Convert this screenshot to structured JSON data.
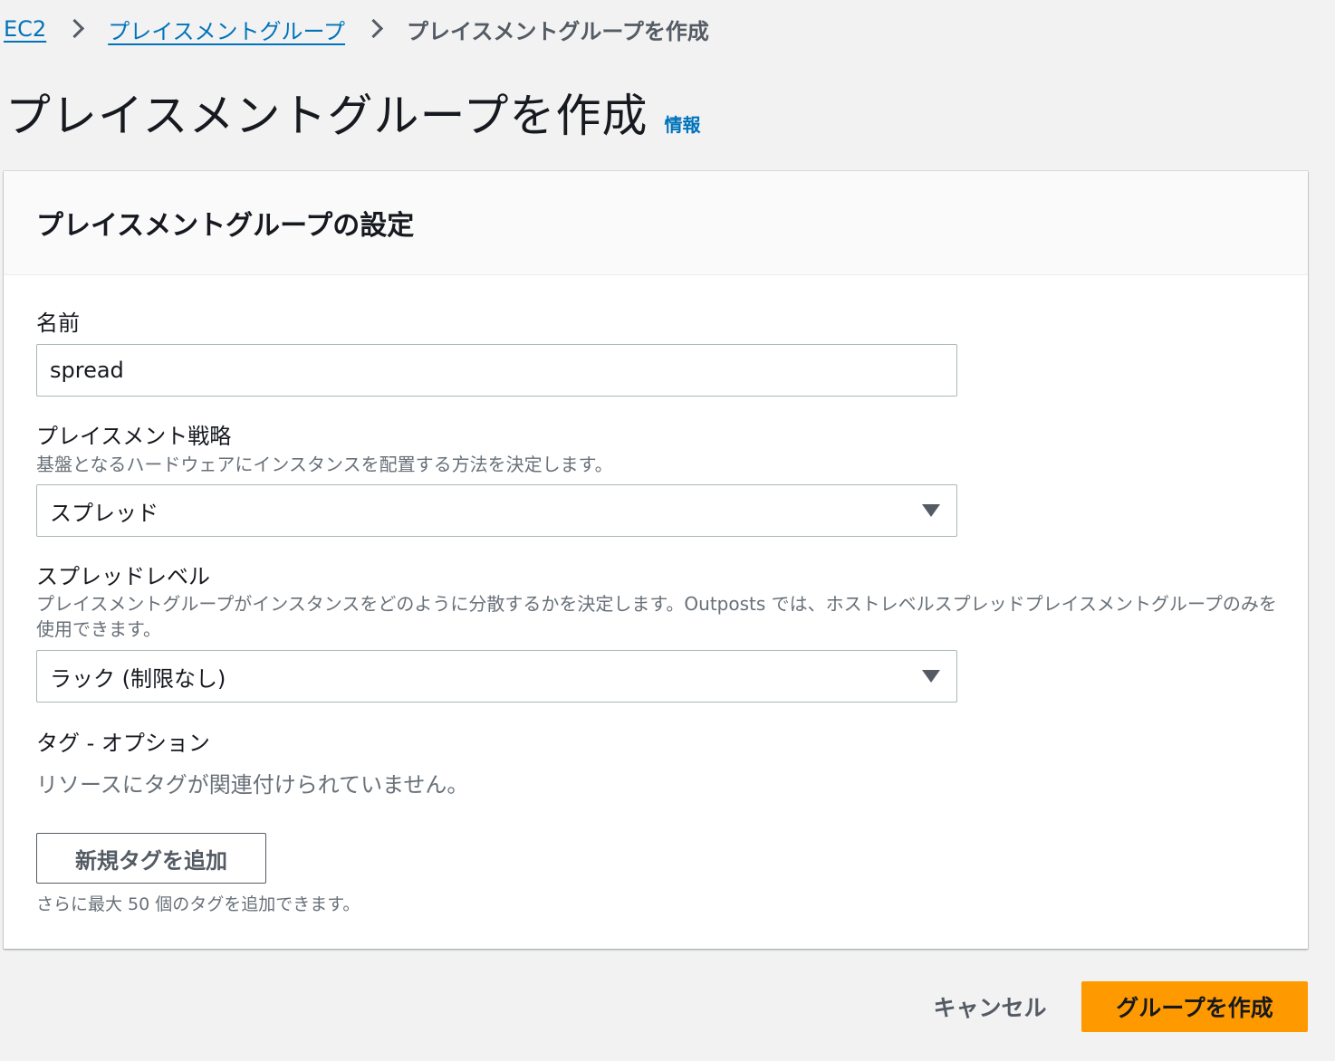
{
  "breadcrumb": {
    "items": [
      "EC2",
      "プレイスメントグループ"
    ],
    "current": "プレイスメントグループを作成"
  },
  "header": {
    "title": "プレイスメントグループを作成",
    "info_link": "情報"
  },
  "settings": {
    "title": "プレイスメントグループの設定",
    "name": {
      "label": "名前",
      "value": "spread"
    },
    "strategy": {
      "label": "プレイスメント戦略",
      "description": "基盤となるハードウェアにインスタンスを配置する方法を決定します。",
      "selected": "スプレッド"
    },
    "spread_level": {
      "label": "スプレッドレベル",
      "description": "プレイスメントグループがインスタンスをどのように分散するかを決定します。Outposts では、ホストレベルスプレッドプレイスメントグループのみを使用できます。",
      "selected": "ラック (制限なし)"
    },
    "tags": {
      "label": "タグ - オプション",
      "empty_text": "リソースにタグが関連付けられていません。",
      "add_button": "新規タグを追加",
      "hint": "さらに最大 50 個のタグを追加できます。"
    }
  },
  "actions": {
    "cancel": "キャンセル",
    "create": "グループを作成"
  },
  "colors": {
    "link": "#0073bb",
    "primary_button": "#ff9900",
    "background": "#f2f2f2"
  }
}
